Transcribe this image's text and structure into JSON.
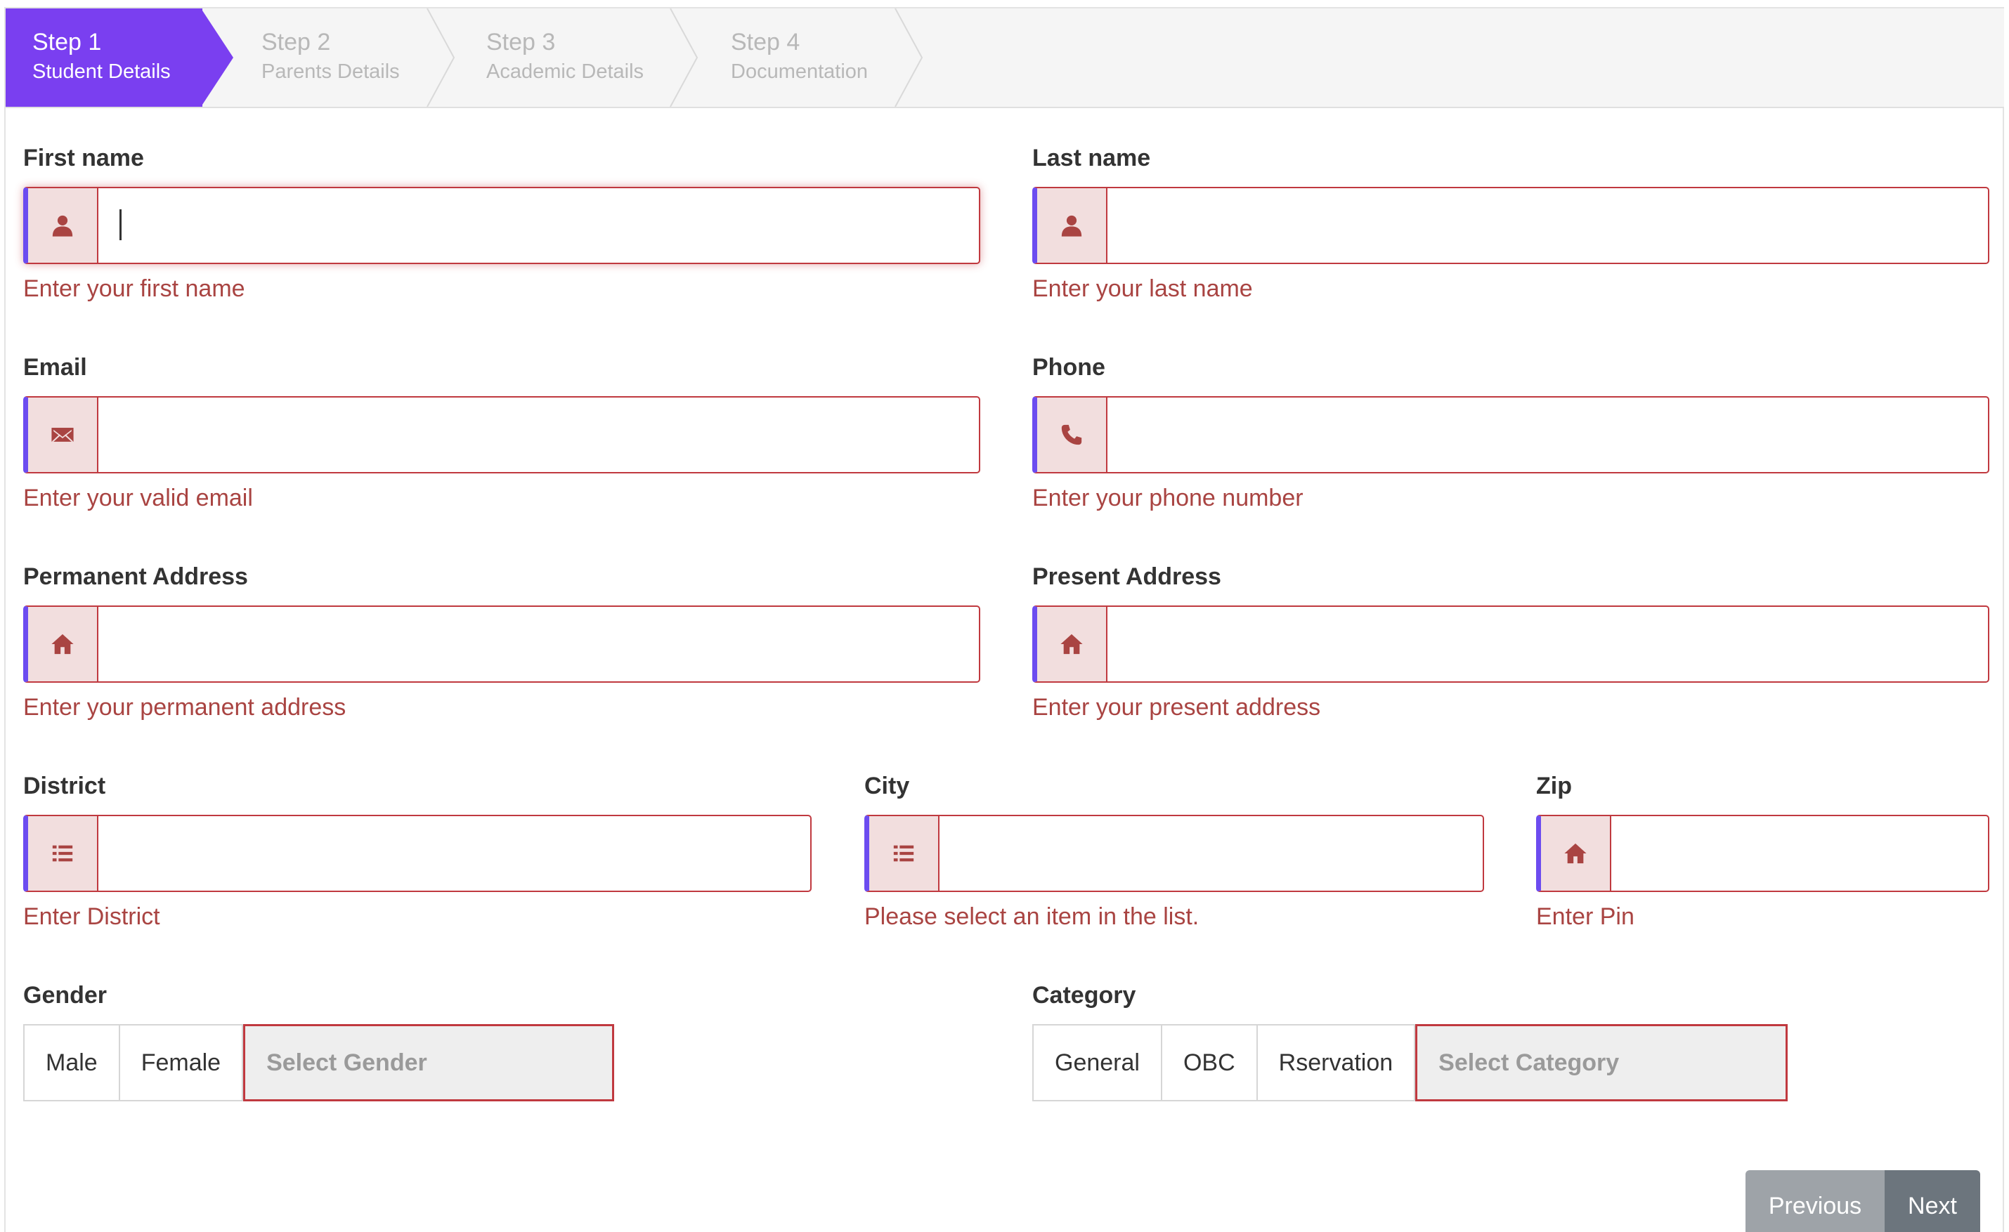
{
  "steps": [
    {
      "num": "Step 1",
      "name": "Student Details",
      "active": true
    },
    {
      "num": "Step 2",
      "name": "Parents Details",
      "active": false
    },
    {
      "num": "Step 3",
      "name": "Academic Details",
      "active": false
    },
    {
      "num": "Step 4",
      "name": "Documentation",
      "active": false
    }
  ],
  "fields": {
    "first_name": {
      "label": "First name",
      "help": "Enter your first name",
      "value": ""
    },
    "last_name": {
      "label": "Last name",
      "help": "Enter your last name",
      "value": ""
    },
    "email": {
      "label": "Email",
      "help": "Enter your valid email",
      "value": ""
    },
    "phone": {
      "label": "Phone",
      "help": "Enter your phone number",
      "value": ""
    },
    "permanent_address": {
      "label": "Permanent Address",
      "help": "Enter your permanent address",
      "value": ""
    },
    "present_address": {
      "label": "Present Address",
      "help": "Enter your present address",
      "value": ""
    },
    "district": {
      "label": "District",
      "help": "Enter District",
      "value": ""
    },
    "city": {
      "label": "City",
      "help": "Please select an item in the list.",
      "value": ""
    },
    "zip": {
      "label": "Zip",
      "help": "Enter Pin",
      "value": ""
    }
  },
  "gender": {
    "label": "Gender",
    "options": [
      "Male",
      "Female"
    ],
    "select_placeholder": "Select Gender"
  },
  "category": {
    "label": "Category",
    "options": [
      "General",
      "OBC",
      "Rservation"
    ],
    "select_placeholder": "Select Category"
  },
  "nav": {
    "previous": "Previous",
    "next": "Next"
  },
  "colors": {
    "accent": "#7a3ff0",
    "error": "#a94442",
    "error_border": "#c0393f",
    "addon_bg": "#f2dede",
    "left_bar": "#6c4cf0"
  }
}
